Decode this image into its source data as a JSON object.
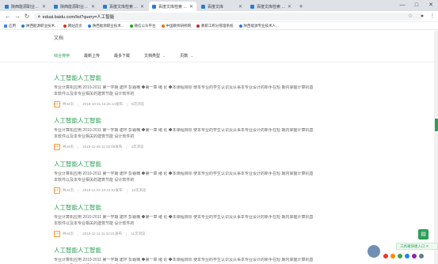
{
  "browser": {
    "tabs": [
      {
        "label": "陕西能源职业技术学院",
        "active": false
      },
      {
        "label": "陕西能源职业技术学院图书馆",
        "active": false
      },
      {
        "label": "百度文库检索 - 百度文库",
        "active": false
      },
      {
        "label": "百度文库检索 - 百度文库",
        "active": true
      },
      {
        "label": "百度文库",
        "active": false
      },
      {
        "label": "百度文库检索 - 百度文库",
        "active": false
      }
    ],
    "new_tab": "+",
    "window_controls": {
      "minimize": "—",
      "maximize": "□",
      "close": "✕"
    },
    "address": "eduai.baidu.com/list?query=人工智能"
  },
  "bookmarks": [
    {
      "label": "应用",
      "color": "#4285f4"
    },
    {
      "label": "陕西能源职业技术...",
      "color": "#2b7bd9"
    },
    {
      "label": "网站首页",
      "color": "#d93025"
    },
    {
      "label": "陕西能源职业技术...",
      "color": "#2b7bd9"
    },
    {
      "label": "微信公众平台",
      "color": "#1aad19"
    },
    {
      "label": "中国教师研修网",
      "color": "#e37400"
    },
    {
      "label": "教职工积分管理系统",
      "color": "#c62828"
    },
    {
      "label": "陕西能源专业技术人...",
      "color": "#2b7bd9"
    }
  ],
  "page": {
    "site_title": "文档",
    "filters": [
      {
        "label": "综合排序",
        "active": true,
        "dropdown": false
      },
      {
        "label": "最新上传",
        "active": false,
        "dropdown": false
      },
      {
        "label": "最多下载",
        "active": false,
        "dropdown": false
      },
      {
        "label": "文档类型",
        "active": false,
        "dropdown": true
      },
      {
        "label": "页数",
        "active": false,
        "dropdown": true
      }
    ],
    "results": [
      {
        "title": "人工智能人工智能",
        "snippet": "专业计算机应用 2010-2011 第一学期 建环 彭霜楠 ◆第一章 绪 论 ◆本课程目标 使本专业的学生认识及从事本专业设计的新手在短 期内掌握计算机基本软件以及本专业相关的建筑节能 设计软件的",
        "file_type": "PPT",
        "pages": "共44页",
        "date": "2018-10-31 15:26:14发布",
        "views": "8次浏览"
      },
      {
        "title": "人工智能人工智能",
        "snippet": "专业计算机应用 2010-2011 第一学期 建环 彭霜楠 ◆第一章 绪 论 ◆本课程目标 使本专业的学生认识及从事本专业设计的新手在短 期内掌握计算机基本软件以及本专业相关的建筑节能 设计软件的",
        "file_type": "PPT",
        "pages": "共44页",
        "date": "2018-11-09 11:02:08发布",
        "views": "4次浏览"
      },
      {
        "title": "人工智能人工智能",
        "snippet": "专业计算机应用 2010-2011 第一学期 建环 彭霜楠 ◆第一章 绪 论 ◆本课程目标 使本专业的学生认识及从事本专业设计的新手在短 期内掌握计算机基本软件以及本专业相关的建筑节能 设计软件的",
        "file_type": "PPT",
        "pages": "共44页",
        "date": "2018-11-03 10:15:02发布",
        "views": "13次浏览"
      },
      {
        "title": "人工智能人工智能",
        "snippet": "专业计算机应用 2010-2011 第一学期 建环 彭霜楠 ◆第一章 绪 论 ◆本课程目标 使本专业的学生认识及从事本专业设计的新手在短 期内掌握计算机基本软件以及本专业相关的建筑节能 设计软件的",
        "file_type": "PPT",
        "pages": "共44页",
        "date": "2018-11-11 11:42:21发布",
        "views": "11次浏览"
      },
      {
        "title": "人工智能人工智能",
        "snippet": "专业计算机应用 2010-2011 第一学期 建环 彭霜楠 ◆第一章 绪 论 ◆本课程目标 使本专业的学生认识及从事本专业设计的新手在短 期内掌握计算机基本软件以及本专业相关的建筑节能 设计软件的",
        "file_type": "PPT",
        "pages": "",
        "date": "",
        "views": ""
      }
    ],
    "tool_entry": "工具箱快捷入口 ✕"
  },
  "colors": {
    "accent": "#2d9f56",
    "ppt": "#f29a38",
    "tabbar": "#dee1e6"
  },
  "icons": [
    "back-icon",
    "forward-icon",
    "reload-icon",
    "lock-icon",
    "star-icon",
    "profile-icon",
    "menu-icon"
  ]
}
